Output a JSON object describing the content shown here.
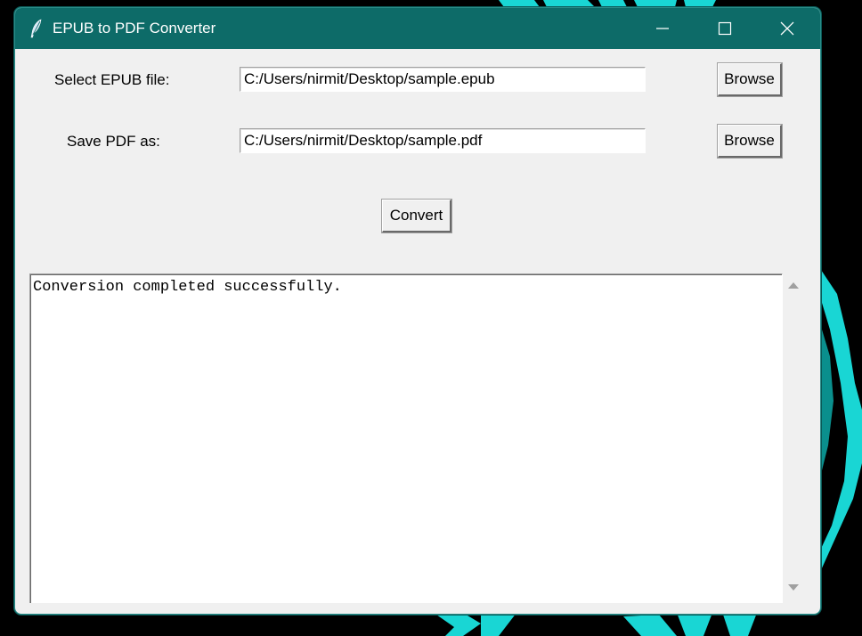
{
  "window": {
    "title": "EPUB to PDF Converter"
  },
  "form": {
    "epub_label": "Select EPUB file:",
    "epub_value": "C:/Users/nirmit/Desktop/sample.epub",
    "pdf_label": "Save PDF as:",
    "pdf_value": "C:/Users/nirmit/Desktop/sample.pdf",
    "browse_label": "Browse",
    "convert_label": "Convert"
  },
  "log": {
    "text": "Conversion completed successfully."
  },
  "icons": {
    "app": "feather-icon",
    "minimize": "minimize-icon",
    "maximize": "maximize-icon",
    "close": "close-icon",
    "scroll_up": "arrow-up-icon",
    "scroll_down": "arrow-down-icon"
  },
  "colors": {
    "titlebar": "#0d6b68",
    "window_bg": "#f0f0f0",
    "wallpaper_accent": "#19d6d4"
  }
}
